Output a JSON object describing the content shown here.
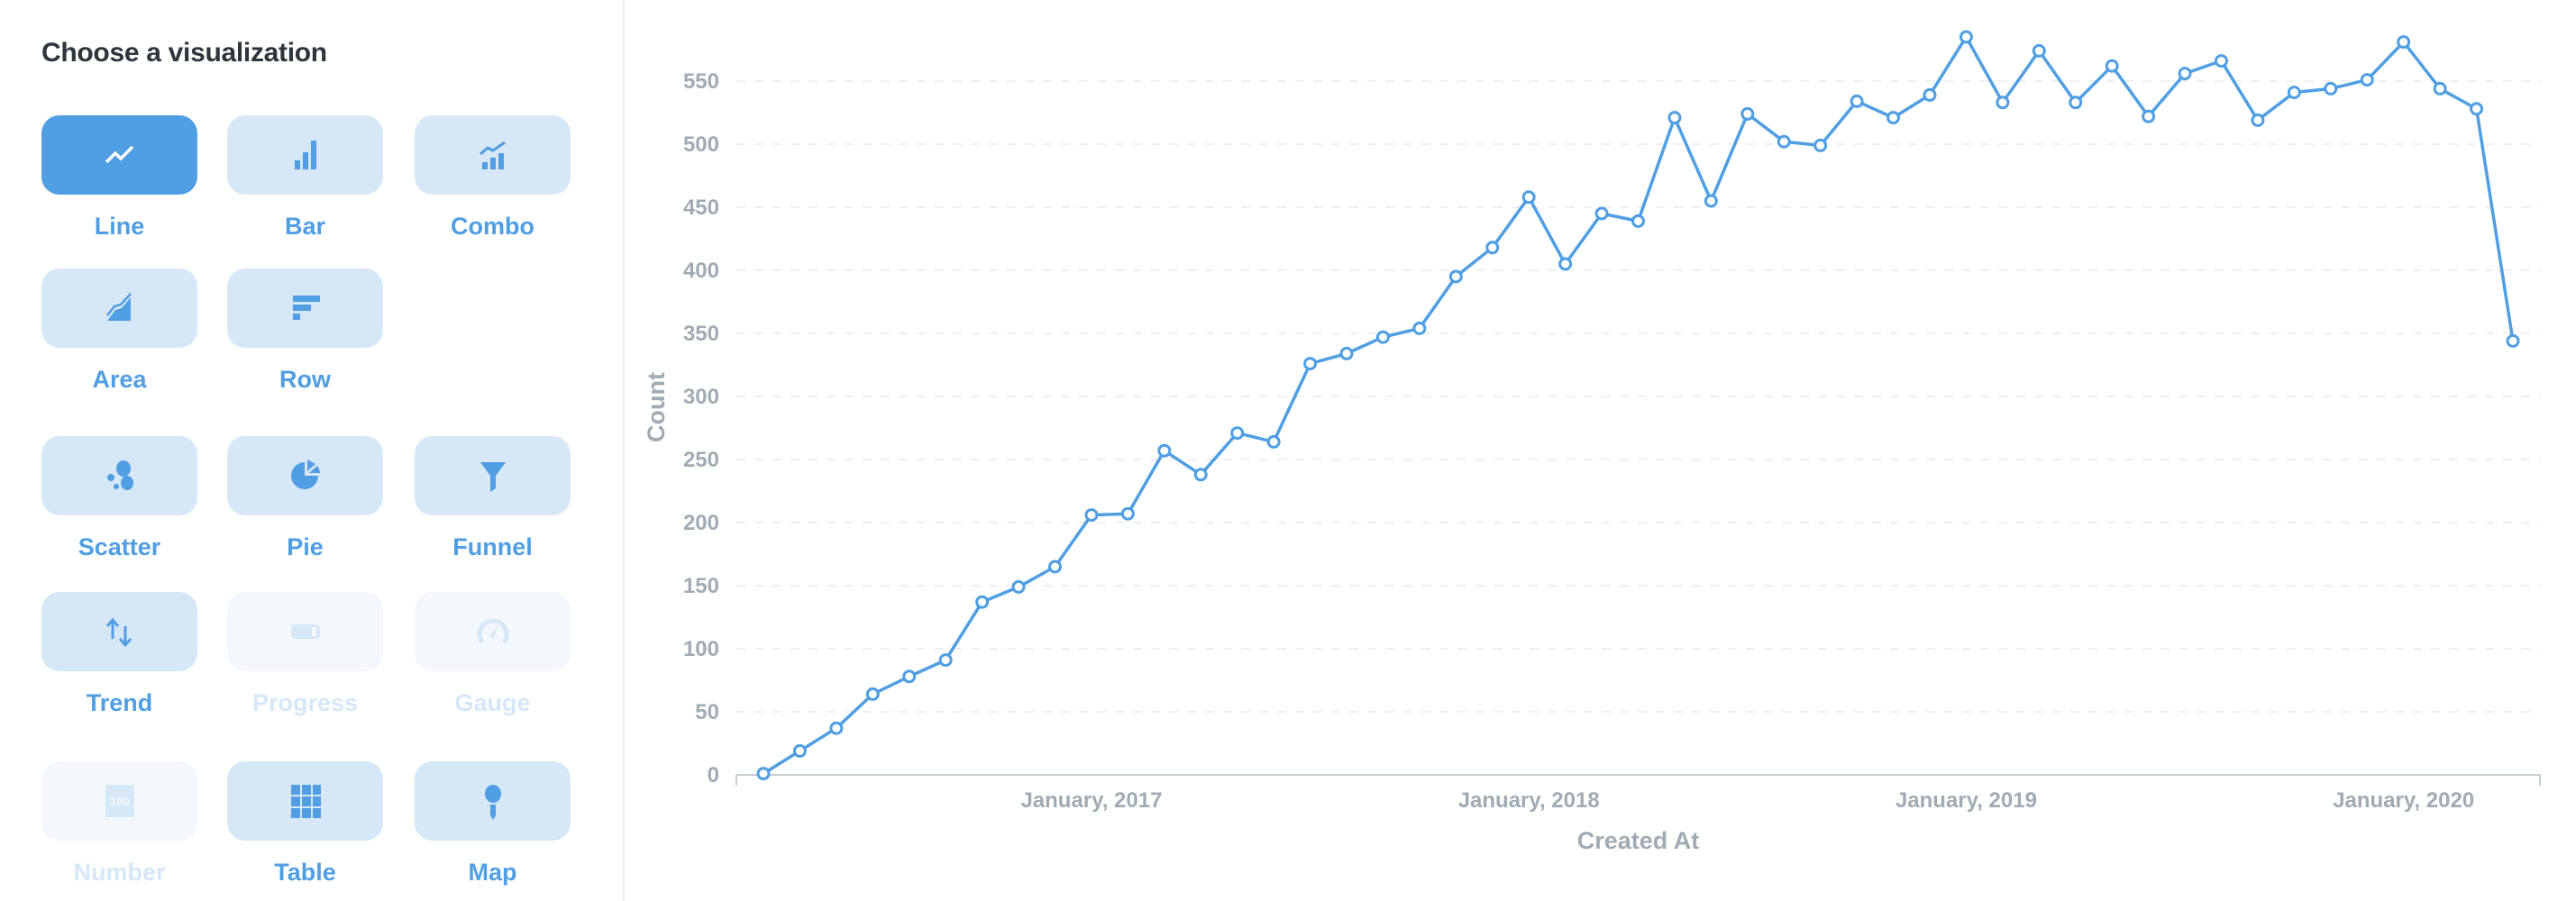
{
  "sidebar": {
    "title": "Choose a visualization",
    "tiles": [
      {
        "label": "Line",
        "icon": "line-chart-icon",
        "state": "active"
      },
      {
        "label": "Bar",
        "icon": "bar-chart-icon",
        "state": "enabled"
      },
      {
        "label": "Combo",
        "icon": "combo-chart-icon",
        "state": "enabled"
      },
      {
        "label": "Area",
        "icon": "area-chart-icon",
        "state": "enabled"
      },
      {
        "label": "Row",
        "icon": "row-chart-icon",
        "state": "enabled"
      },
      {
        "label": "Scatter",
        "icon": "scatter-chart-icon",
        "state": "enabled"
      },
      {
        "label": "Pie",
        "icon": "pie-chart-icon",
        "state": "enabled"
      },
      {
        "label": "Funnel",
        "icon": "funnel-icon",
        "state": "enabled"
      },
      {
        "label": "Trend",
        "icon": "trend-arrows-icon",
        "state": "enabled"
      },
      {
        "label": "Progress",
        "icon": "progress-bar-icon",
        "state": "disabled"
      },
      {
        "label": "Gauge",
        "icon": "gauge-icon",
        "state": "disabled"
      },
      {
        "label": "Number",
        "icon": "number-icon",
        "state": "disabled",
        "icon_text": "100"
      },
      {
        "label": "Table",
        "icon": "table-grid-icon",
        "state": "enabled"
      },
      {
        "label": "Map",
        "icon": "map-pin-icon",
        "state": "enabled"
      }
    ]
  },
  "colors": {
    "accent": "#509EE3",
    "tile_bg": "#D6E7F7",
    "tile_disabled_bg": "#F4F8FD",
    "axis_text": "#A1ABB4",
    "title_text": "#2E353B",
    "gridline": "#EDEFF1",
    "axis_line": "#C9CED3"
  },
  "chart_data": {
    "type": "line",
    "title": "",
    "xlabel": "Created At",
    "ylabel": "Count",
    "ylim": [
      0,
      600
    ],
    "yticks": [
      0,
      50,
      100,
      150,
      200,
      250,
      300,
      350,
      400,
      450,
      500,
      550
    ],
    "grid": true,
    "legend": "none",
    "x_tick_labels": [
      {
        "label": "January, 2017",
        "x": "2017-01"
      },
      {
        "label": "January, 2018",
        "x": "2018-01"
      },
      {
        "label": "January, 2019",
        "x": "2019-01"
      },
      {
        "label": "January, 2020",
        "x": "2020-01"
      }
    ],
    "x": [
      "2016-04",
      "2016-05",
      "2016-06",
      "2016-07",
      "2016-08",
      "2016-09",
      "2016-10",
      "2016-11",
      "2016-12",
      "2017-01",
      "2017-02",
      "2017-03",
      "2017-04",
      "2017-05",
      "2017-06",
      "2017-07",
      "2017-08",
      "2017-09",
      "2017-10",
      "2017-11",
      "2017-12",
      "2018-01",
      "2018-02",
      "2018-03",
      "2018-04",
      "2018-05",
      "2018-06",
      "2018-07",
      "2018-08",
      "2018-09",
      "2018-10",
      "2018-11",
      "2018-12",
      "2019-01",
      "2019-02",
      "2019-03",
      "2019-04",
      "2019-05",
      "2019-06",
      "2019-07",
      "2019-08",
      "2019-09",
      "2019-10",
      "2019-11",
      "2019-12",
      "2020-01",
      "2020-02",
      "2020-03",
      "2020-04"
    ],
    "series": [
      {
        "name": "Count",
        "color": "#509EE3",
        "values": [
          1,
          19,
          37,
          64,
          78,
          91,
          137,
          149,
          165,
          206,
          207,
          257,
          238,
          271,
          264,
          326,
          334,
          347,
          354,
          395,
          418,
          458,
          405,
          445,
          439,
          521,
          455,
          524,
          502,
          499,
          534,
          521,
          539,
          585,
          533,
          574,
          533,
          562,
          522,
          556,
          566,
          519,
          541,
          544,
          551,
          581,
          544,
          528,
          344
        ]
      }
    ]
  }
}
